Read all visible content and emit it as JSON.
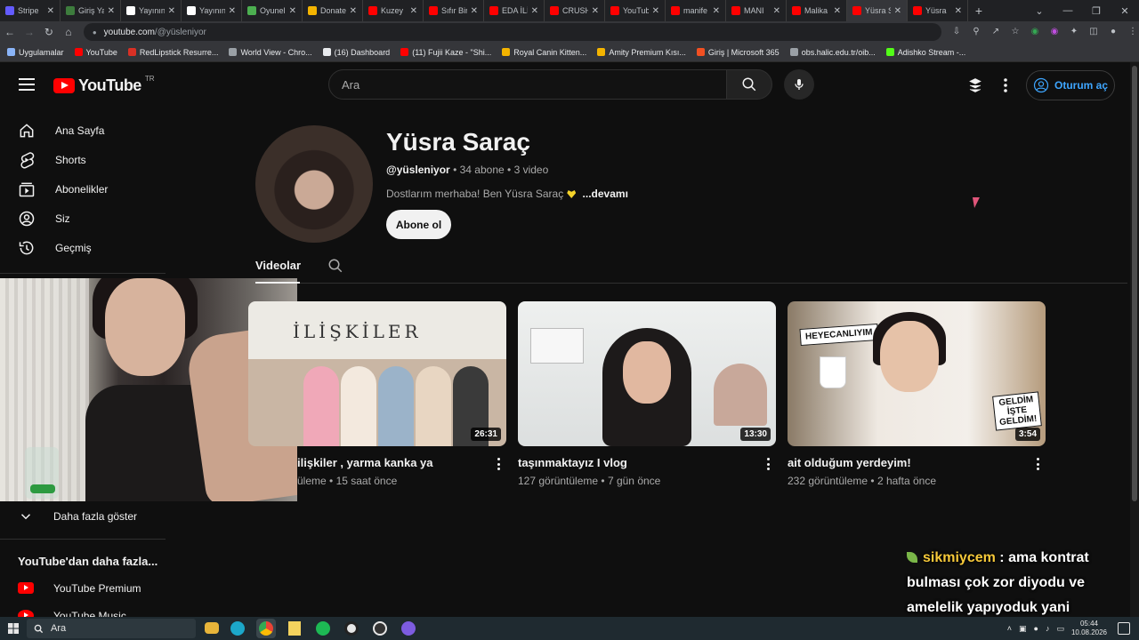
{
  "browser": {
    "tabs": [
      {
        "label": "Stripe",
        "color": "#635bff"
      },
      {
        "label": "Giriş Ya",
        "color": "#3d7c3d"
      },
      {
        "label": "Yayının",
        "color": "#ffffff"
      },
      {
        "label": "Yayının",
        "color": "#ffffff"
      },
      {
        "label": "Oyunel",
        "color": "#4caf50"
      },
      {
        "label": "Donate",
        "color": "#f4b400"
      },
      {
        "label": "Kuzey",
        "color": "#ff0000"
      },
      {
        "label": "Sıfır Bir",
        "color": "#ff0000"
      },
      {
        "label": "EDA İLİ",
        "color": "#ff0000"
      },
      {
        "label": "CRUSH",
        "color": "#ff0000"
      },
      {
        "label": "YouTub",
        "color": "#ff0000"
      },
      {
        "label": "manife",
        "color": "#ff0000"
      },
      {
        "label": "MANI",
        "color": "#ff0000"
      },
      {
        "label": "Malika",
        "color": "#ff0000"
      },
      {
        "label": "Yüsra S",
        "color": "#ff0000"
      },
      {
        "label": "Yüsra",
        "color": "#ff0000"
      }
    ],
    "active_tab_index": 14,
    "url_host": "youtube.com",
    "url_path": "/@yüsleniyor",
    "bookmarks": [
      {
        "label": "Uygulamalar",
        "color": "#8ab4f8"
      },
      {
        "label": "YouTube",
        "color": "#ff0000"
      },
      {
        "label": "RedLipstick Resurre...",
        "color": "#d93025"
      },
      {
        "label": "World View - Chro...",
        "color": "#9aa0a6"
      },
      {
        "label": "(16) Dashboard",
        "color": "#e8eaed"
      },
      {
        "label": "(11) Fujii Kaze - \"Shi...",
        "color": "#ff0000"
      },
      {
        "label": "Royal Canin Kitten...",
        "color": "#f4b400"
      },
      {
        "label": "Amity Premium Kısı...",
        "color": "#f4b400"
      },
      {
        "label": "Giriş | Microsoft 365",
        "color": "#f25022"
      },
      {
        "label": "obs.halic.edu.tr/oib...",
        "color": "#9aa0a6"
      },
      {
        "label": "Adishko Stream -...",
        "color": "#53fc18"
      }
    ]
  },
  "youtube": {
    "logo_text": "YouTube",
    "logo_region": "TR",
    "search_placeholder": "Ara",
    "signin_label": "Oturum aç",
    "accent": "#3ea6ff",
    "sidebar": {
      "items": [
        {
          "label": "Ana Sayfa",
          "icon": "home-icon"
        },
        {
          "label": "Shorts",
          "icon": "shorts-icon"
        },
        {
          "label": "Abonelikler",
          "icon": "subscriptions-icon"
        },
        {
          "label": "Siz",
          "icon": "user-icon"
        },
        {
          "label": "Geçmiş",
          "icon": "history-icon"
        }
      ],
      "show_more": "Daha fazla göster",
      "section_title": "YouTube'dan daha fazla...",
      "more_items": [
        {
          "label": "YouTube Premium"
        },
        {
          "label": "YouTube Music"
        }
      ]
    },
    "channel": {
      "name": "Yüsra Saraç",
      "handle": "@yüsleniyor",
      "subs": "34 abone",
      "videos_count": "3 video",
      "description": "Dostlarım merhaba! Ben Yüsra Saraç",
      "more": "...devamı",
      "subscribe_label": "Abone ol",
      "tab_videos": "Videolar"
    },
    "videos": [
      {
        "thumb_text": "İLİŞKİLER",
        "title": "ilişkiler , yarma kanka ya",
        "views": "üleme",
        "age": "15 saat önce",
        "duration": "26:31"
      },
      {
        "thumb_text": "",
        "title": "taşınmaktayız I vlog",
        "views": "127 görüntüleme",
        "age": "7 gün önce",
        "duration": "13:30"
      },
      {
        "thumb_text": "HEYECANLIYIM",
        "thumb_text2": "GELDİM İŞTE GELDİM!",
        "title": "ait olduğum yerdeyim!",
        "views": "232 görüntüleme",
        "age": "2 hafta önce",
        "duration": "3:54"
      }
    ]
  },
  "chat": {
    "user": "sikmiycem",
    "message": "ama kontrat bulması çok zor diyodu ve amelelik yapıyoduk yani"
  },
  "taskbar": {
    "search_placeholder": "Ara",
    "time": "05:44",
    "date": "10.08.2026"
  }
}
